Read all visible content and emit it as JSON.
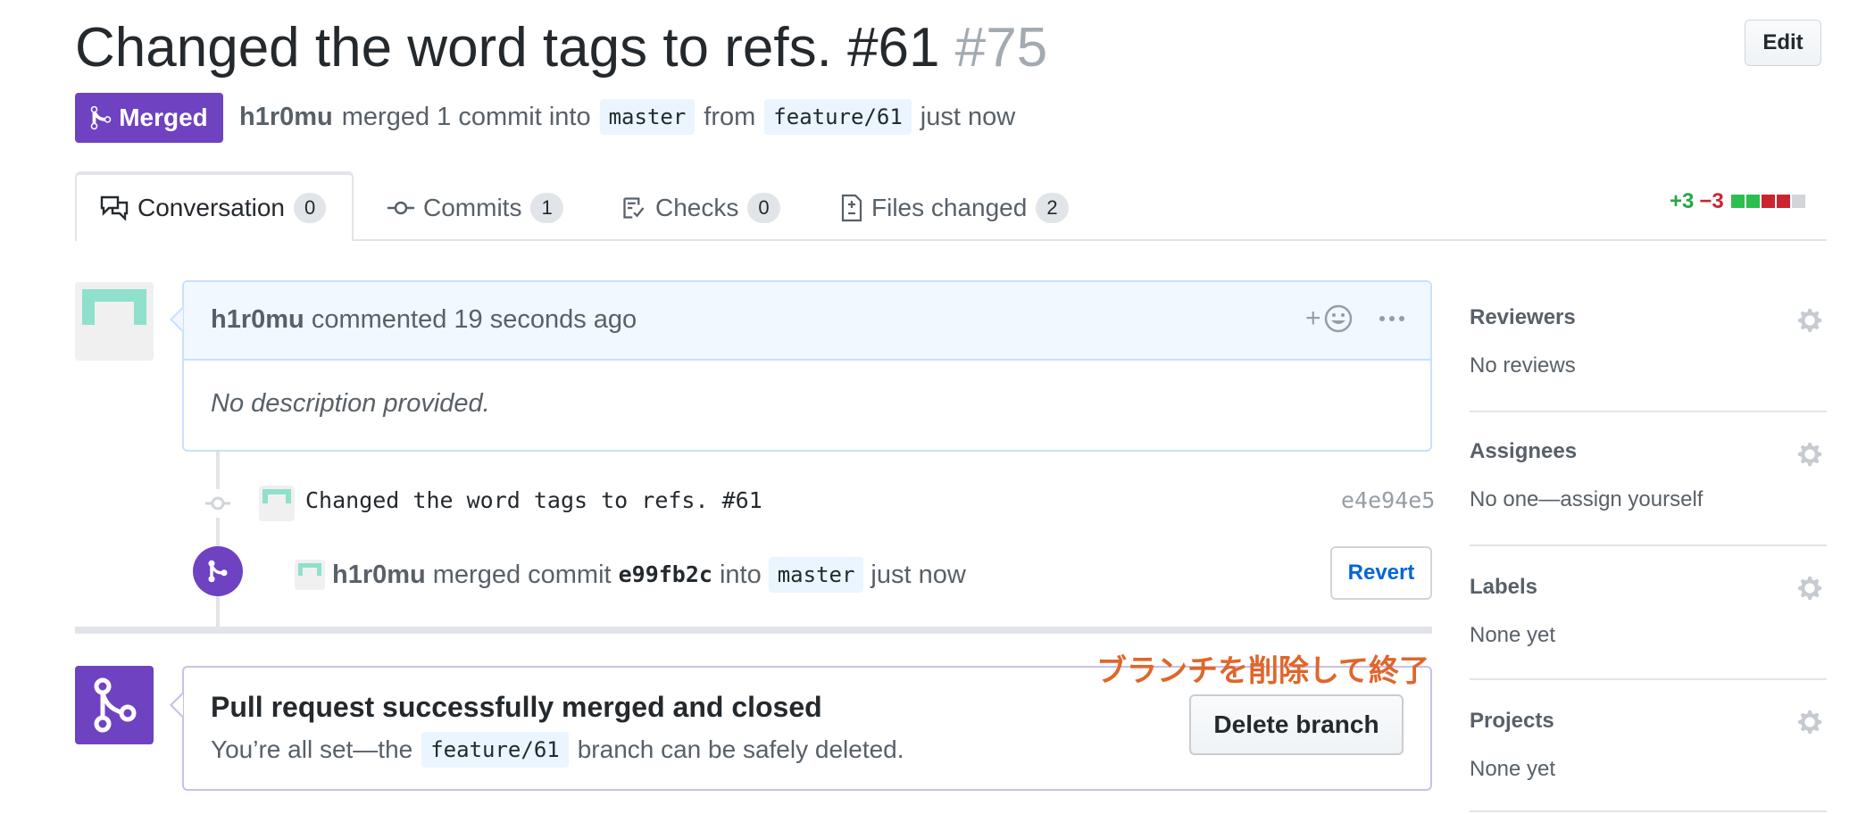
{
  "header": {
    "title": "Changed the word tags to refs. #61",
    "number": "#75",
    "edit_label": "Edit",
    "state_label": "Merged",
    "author": "h1r0mu",
    "merged_text": "merged 1 commit into",
    "base_branch": "master",
    "from_text": "from",
    "head_branch": "feature/61",
    "time": "just now"
  },
  "tabs": [
    {
      "label": "Conversation",
      "count": "0"
    },
    {
      "label": "Commits",
      "count": "1"
    },
    {
      "label": "Checks",
      "count": "0"
    },
    {
      "label": "Files changed",
      "count": "2"
    }
  ],
  "diffstat": {
    "additions": "+3",
    "deletions": "−3"
  },
  "comment": {
    "author": "h1r0mu",
    "action": "commented",
    "time": "19 seconds ago",
    "add_reaction": "+",
    "body": "No description provided."
  },
  "commit": {
    "message": "Changed the word tags to refs. #61",
    "sha": "e4e94e5"
  },
  "merge_event": {
    "author": "h1r0mu",
    "text": "merged commit",
    "sha": "e99fb2c",
    "into": "into",
    "branch": "master",
    "time": "just now",
    "revert_label": "Revert"
  },
  "merged_box": {
    "title": "Pull request successfully merged and closed",
    "sub_prefix": "You’re all set—the",
    "branch": "feature/61",
    "sub_suffix": "branch can be safely deleted.",
    "delete_label": "Delete branch",
    "annotation": "ブランチを削除して終了"
  },
  "sidebar": {
    "sections": [
      {
        "heading": "Reviewers",
        "value": "No reviews"
      },
      {
        "heading": "Assignees",
        "value": "No one—assign yourself"
      },
      {
        "heading": "Labels",
        "value": "None yet"
      },
      {
        "heading": "Projects",
        "value": "None yet"
      }
    ]
  },
  "colors": {
    "merged_purple": "#6f42c1",
    "add_green": "#28a745",
    "del_red": "#cb2431",
    "annotation_orange": "#e0662a"
  },
  "icons": [
    "merge-icon",
    "comment-discussion-icon",
    "git-commit-icon",
    "checklist-icon",
    "file-diff-icon",
    "smiley-icon",
    "kebab-icon",
    "gear-icon"
  ]
}
